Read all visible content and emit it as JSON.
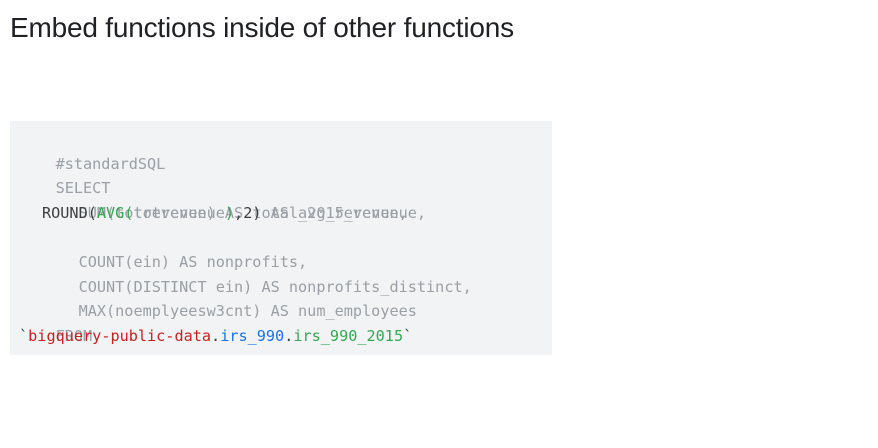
{
  "slide": {
    "title": "Embed functions inside of other functions"
  },
  "code": {
    "comment": "#standardSQL",
    "select_kw": "SELECT",
    "line_sum": "SUM(totrevenue) AS total_2015_revenue,",
    "round_fn": "ROUND(",
    "avg_fn": "AVG(",
    "avg_arg": "totrevenue",
    "avg_close": ")",
    "round_tail": ",2)",
    "avg_alias": " AS avg_revenue,",
    "line_count": "COUNT(ein) AS nonprofits,",
    "line_count_distinct": "COUNT(DISTINCT ein) AS nonprofits_distinct,",
    "line_max": "MAX(noemplyeesw3cnt) AS num_employees",
    "from_kw": "FROM",
    "tick_open": "`",
    "project": "bigquery-public-data",
    "dot1": ".",
    "dataset": "irs_990",
    "dot2": ".",
    "table": "irs_990_2015",
    "tick_close": "`"
  },
  "colors": {
    "background": "#ffffff",
    "code_background": "#f1f3f4",
    "dimmed_text": "#9aa0a6",
    "highlight_text": "#3c4043",
    "function_green": "#34a853",
    "project_red": "#c5221f",
    "dataset_blue": "#1a73e8"
  }
}
